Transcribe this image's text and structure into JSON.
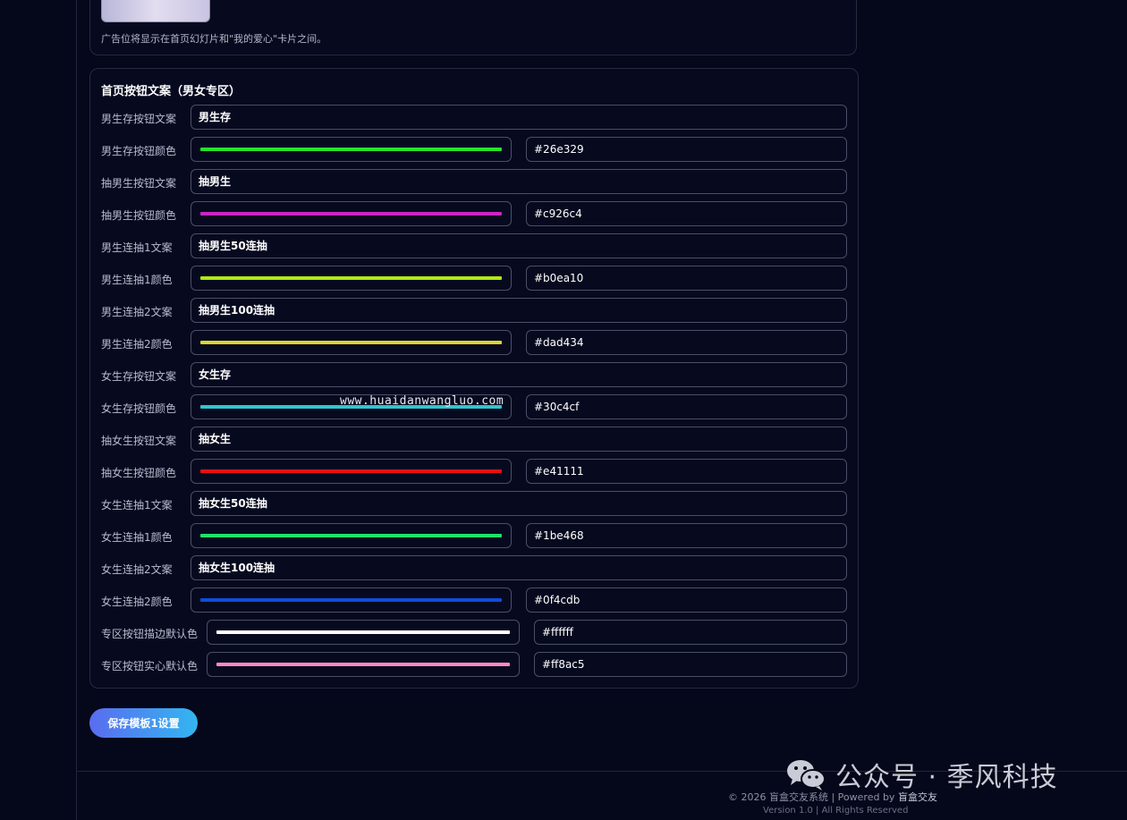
{
  "ad_section": {
    "note": "广告位将显示在首页幻灯片和\"我的爱心\"卡片之间。"
  },
  "panel": {
    "title": "首页按钮文案（男女专区）",
    "rows": [
      {
        "label": "男生存按钮文案",
        "type": "text",
        "value": "男生存"
      },
      {
        "label": "男生存按钮颜色",
        "type": "color",
        "value": "#26e329",
        "color": "#26e329"
      },
      {
        "label": "抽男生按钮文案",
        "type": "text",
        "value": "抽男生"
      },
      {
        "label": "抽男生按钮颜色",
        "type": "color",
        "value": "#c926c4",
        "color": "#c926c4"
      },
      {
        "label": "男生连抽1文案",
        "type": "text",
        "value": "抽男生50连抽"
      },
      {
        "label": "男生连抽1颜色",
        "type": "color",
        "value": "#b0ea10",
        "color": "#b0ea10"
      },
      {
        "label": "男生连抽2文案",
        "type": "text",
        "value": "抽男生100连抽"
      },
      {
        "label": "男生连抽2颜色",
        "type": "color",
        "value": "#dad434",
        "color": "#dad434"
      },
      {
        "label": "女生存按钮文案",
        "type": "text",
        "value": "女生存"
      },
      {
        "label": "女生存按钮颜色",
        "type": "color",
        "value": "#30c4cf",
        "color": "#30c4cf"
      },
      {
        "label": "抽女生按钮文案",
        "type": "text",
        "value": "抽女生"
      },
      {
        "label": "抽女生按钮颜色",
        "type": "color",
        "value": "#e41111",
        "color": "#e41111"
      },
      {
        "label": "女生连抽1文案",
        "type": "text",
        "value": "抽女生50连抽"
      },
      {
        "label": "女生连抽1颜色",
        "type": "color",
        "value": "#1be468",
        "color": "#1be468"
      },
      {
        "label": "女生连抽2文案",
        "type": "text",
        "value": "抽女生100连抽"
      },
      {
        "label": "女生连抽2颜色",
        "type": "color",
        "value": "#0f4cdb",
        "color": "#0f4cdb"
      },
      {
        "label": "专区按钮描边默认色",
        "type": "color",
        "value": "#ffffff",
        "color": "#ffffff",
        "wide": true
      },
      {
        "label": "专区按钮实心默认色",
        "type": "color",
        "value": "#ff8ac5",
        "color": "#ff8ac5",
        "wide": true
      }
    ]
  },
  "watermark": "www.huaidanwangluo.com",
  "save_button": {
    "label": "保存模板1设置"
  },
  "footer": {
    "copyright": "© 2026 盲盒交友系统 | Powered by ",
    "brand": "盲盒交友",
    "version": "Version 1.0 | All Rights Reserved"
  },
  "wechat_badge": {
    "text": "公众号 · 季风科技",
    "icon": "wechat-icon"
  }
}
